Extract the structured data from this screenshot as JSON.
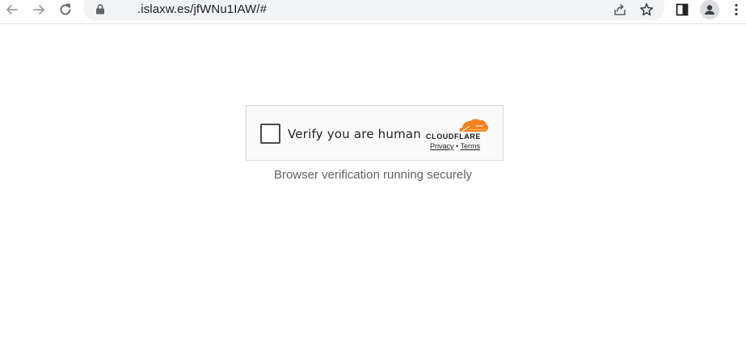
{
  "browser": {
    "url": ".islaxw.es/jfWNu1IAW/#",
    "icons": {
      "back": "arrow-left-icon",
      "forward": "arrow-right-icon",
      "reload": "reload-icon",
      "lock": "lock-icon",
      "share": "share-icon",
      "bookmark": "star-icon",
      "side_panel": "side-panel-icon",
      "profile": "profile-icon",
      "menu": "kebab-menu-icon"
    }
  },
  "challenge": {
    "checkbox_label": "Verify you are human",
    "brand": "CLOUDFLARE",
    "privacy_link": "Privacy",
    "separator": "•",
    "terms_link": "Terms",
    "brand_color": "#f48120"
  },
  "status": {
    "message": "Browser verification running securely"
  }
}
